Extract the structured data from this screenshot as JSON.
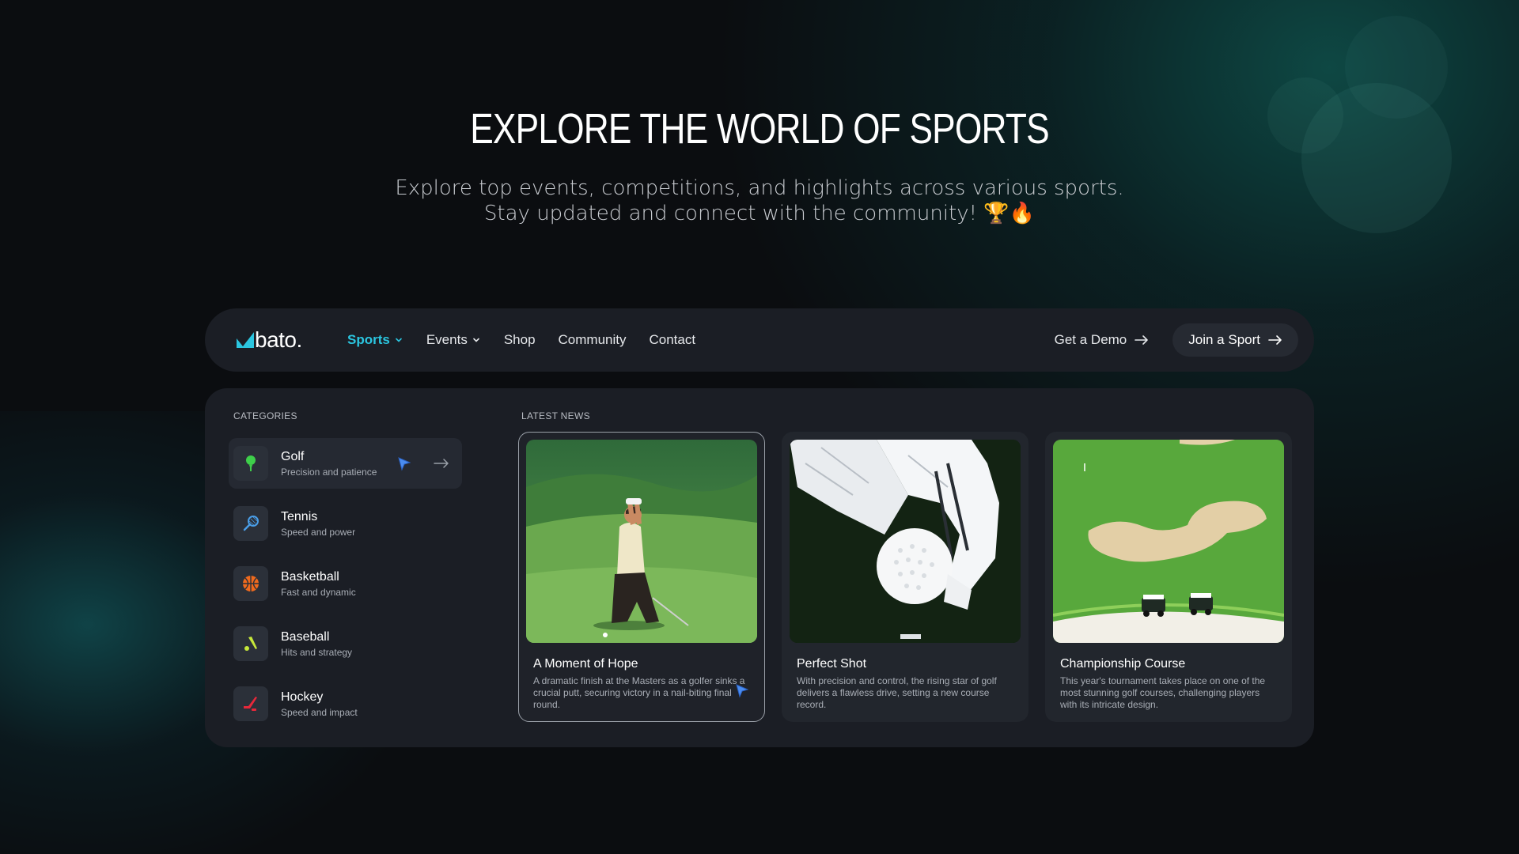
{
  "hero": {
    "title": "EXPLORE THE WORLD OF SPORTS",
    "subtitle_line1": "Explore top events, competitions, and highlights across various sports.",
    "subtitle_line2": "Stay updated and connect with the community! 🏆🔥"
  },
  "nav": {
    "logo_text": "bato.",
    "links": [
      {
        "label": "Sports",
        "active": true,
        "dropdown": true
      },
      {
        "label": "Events",
        "active": false,
        "dropdown": true
      },
      {
        "label": "Shop",
        "active": false,
        "dropdown": false
      },
      {
        "label": "Community",
        "active": false,
        "dropdown": false
      },
      {
        "label": "Contact",
        "active": false,
        "dropdown": false
      }
    ],
    "demo_label": "Get a Demo",
    "join_label": "Join a Sport"
  },
  "menu": {
    "categories_label": "CATEGORIES",
    "news_label": "LATEST NEWS",
    "categories": [
      {
        "name": "Golf",
        "desc": "Precision and patience",
        "icon": "golf-tee-icon",
        "color": "#3ecf4a"
      },
      {
        "name": "Tennis",
        "desc": "Speed and power",
        "icon": "tennis-racket-icon",
        "color": "#4a9ee8"
      },
      {
        "name": "Basketball",
        "desc": "Fast and dynamic",
        "icon": "basketball-icon",
        "color": "#f06a1d"
      },
      {
        "name": "Baseball",
        "desc": "Hits and strategy",
        "icon": "baseball-bat-icon",
        "color": "#c7e83a"
      },
      {
        "name": "Hockey",
        "desc": "Speed and impact",
        "icon": "hockey-stick-icon",
        "color": "#e8283a"
      }
    ],
    "news": [
      {
        "title": "A Moment of Hope",
        "text": "A dramatic finish at the Masters as a golfer sinks a crucial putt, securing victory in a nail-biting final round.",
        "image": "golfer-kneeling-image"
      },
      {
        "title": "Perfect Shot",
        "text": "With precision and control, the rising star of golf delivers a flawless drive, setting a new course record.",
        "image": "gloved-hand-golf-ball-image"
      },
      {
        "title": "Championship Course",
        "text": "This year's tournament takes place on one of the most stunning golf courses, challenging players with its intricate design.",
        "image": "golf-course-aerial-image"
      }
    ]
  },
  "colors": {
    "accent": "#2bc6e0",
    "panel": "#1b1e25",
    "background": "#0b0d10",
    "cursor": "#4a8cf0"
  }
}
